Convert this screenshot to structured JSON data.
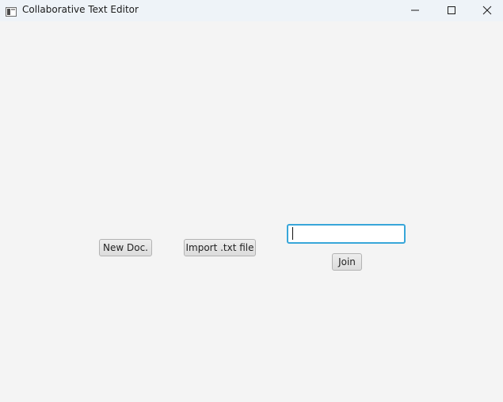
{
  "window": {
    "title": "Collaborative Text Editor"
  },
  "window_controls": {
    "minimize_icon": "minimize-icon",
    "maximize_icon": "maximize-icon",
    "close_icon": "close-icon"
  },
  "main": {
    "new_doc_label": "New Doc.",
    "import_label": "Import .txt file",
    "join_label": "Join",
    "join_code_value": "",
    "join_code_placeholder": ""
  },
  "colors": {
    "focus_border": "#38a6d9",
    "background": "#f4f4f4",
    "titlebar": "#eef3f8"
  }
}
